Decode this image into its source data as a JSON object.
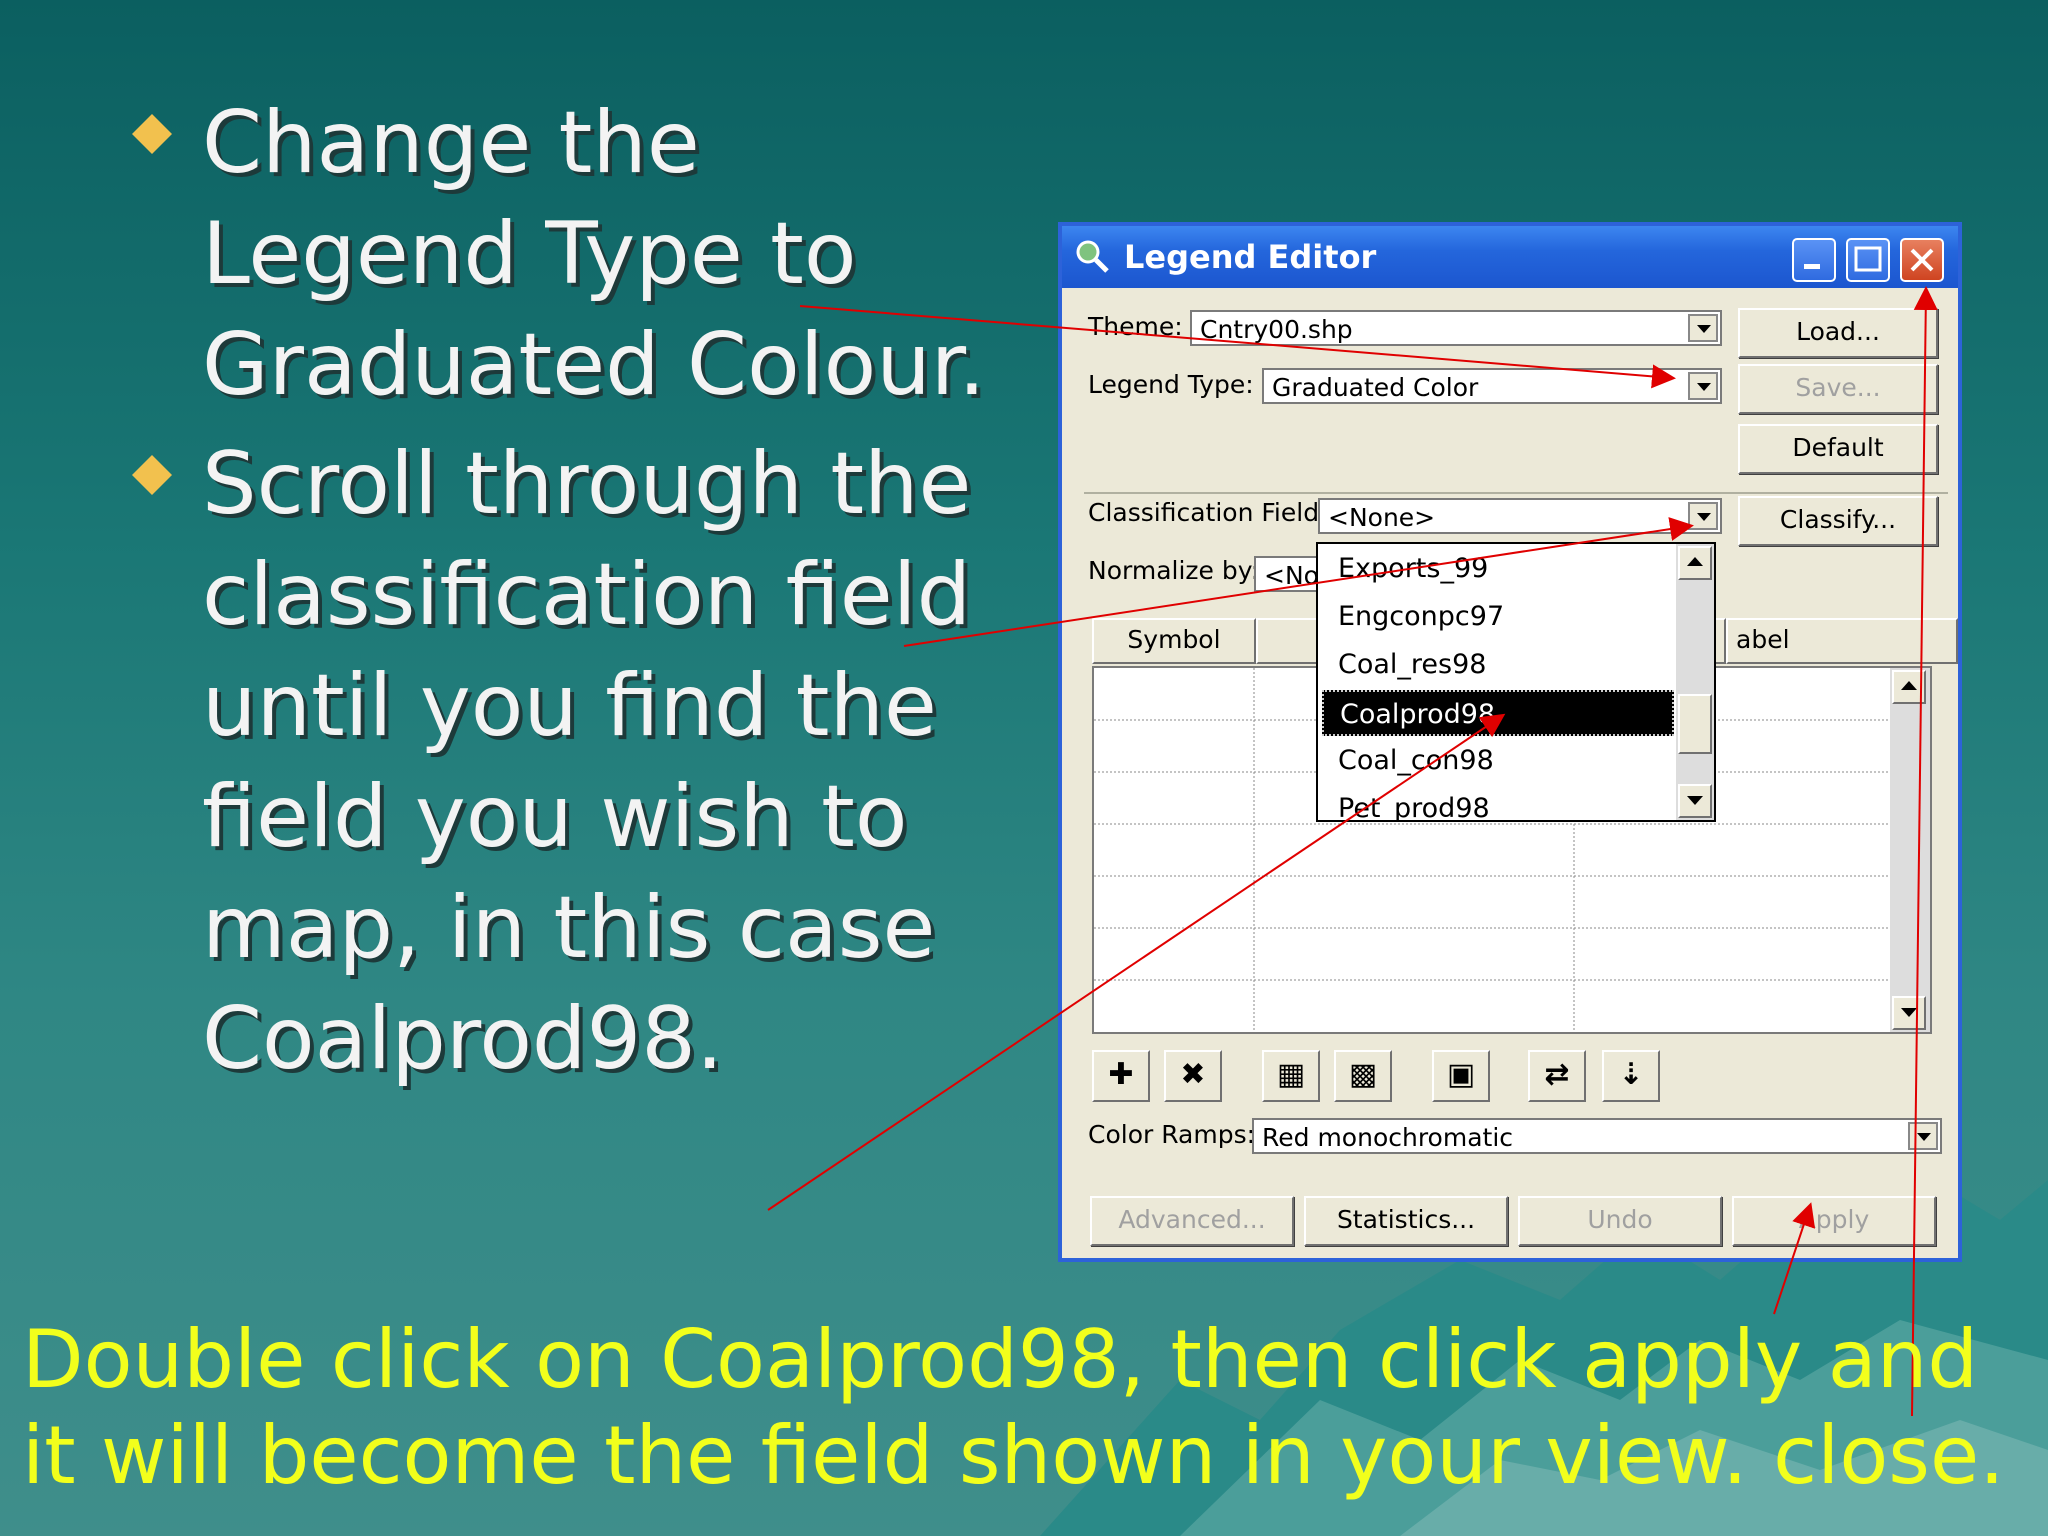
{
  "bullets": [
    "Change the Legend Type to Graduated Colour.",
    "Scroll through the classification field until you find the field you wish to map, in this case Coalprod98."
  ],
  "footer_line1": "Double click on Coalprod98, then click apply and",
  "footer_line2": "it will become the field shown in your view. close.",
  "colors": {
    "bullet_diamond": "#f2c14e",
    "footer_text": "#f2ff1c",
    "arrow": "#e00000"
  },
  "dialog": {
    "title": "Legend Editor",
    "theme_label": "Theme:",
    "theme_value": "Cntry00.shp",
    "legend_type_label": "Legend Type:",
    "legend_type_value": "Graduated Color",
    "buttons": {
      "load": "Load...",
      "save": "Save...",
      "default": "Default",
      "classify": "Classify..."
    },
    "classification_label": "Classification Field:",
    "classification_value": "<None>",
    "normalize_label": "Normalize by:",
    "normalize_value": "<No",
    "columns": {
      "symbol": "Symbol",
      "label": "abel"
    },
    "dropdown_items": [
      "Exports_99",
      "Engconpc97",
      "Coal_res98",
      "Coalprod98",
      "Coal_con98",
      "Pet_prod98"
    ],
    "dropdown_selected": "Coalprod98",
    "color_ramps_label": "Color Ramps:",
    "color_ramps_value": "Red monochromatic",
    "bottom_buttons": {
      "advanced": "Advanced...",
      "statistics": "Statistics...",
      "undo": "Undo",
      "apply": "Apply"
    }
  }
}
